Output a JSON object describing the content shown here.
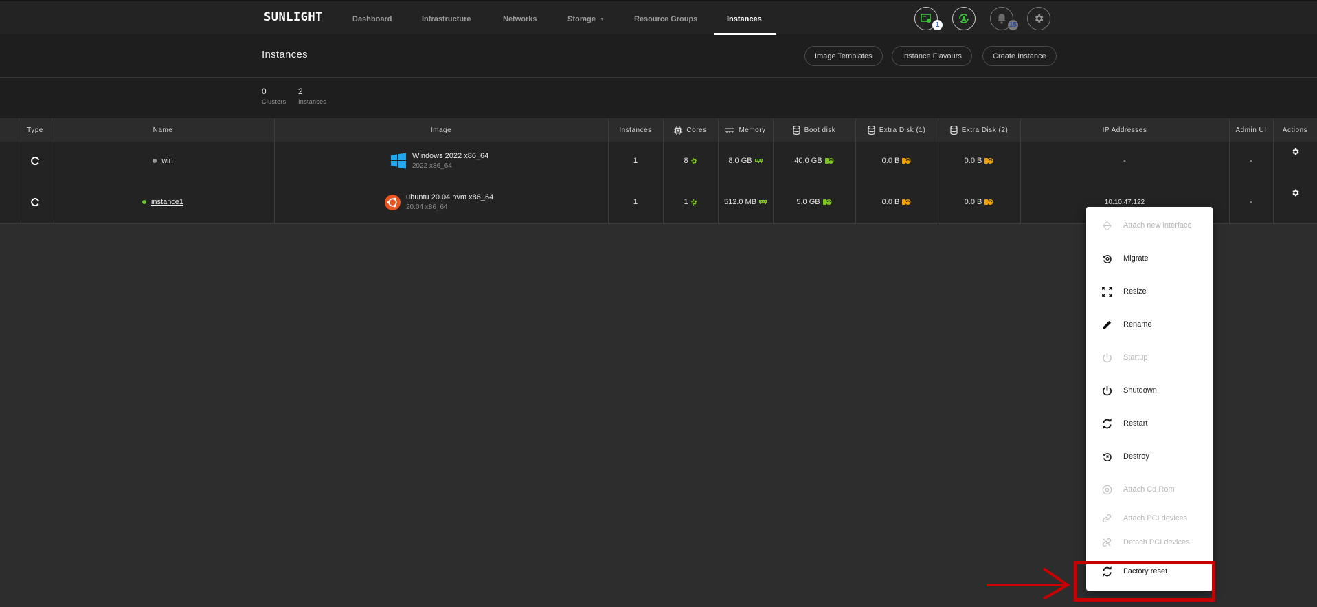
{
  "nav": {
    "logo": "SUNLIGHT",
    "items": [
      {
        "label": "Dashboard",
        "active": false
      },
      {
        "label": "Infrastructure",
        "active": false
      },
      {
        "label": "Networks",
        "active": false
      },
      {
        "label": "Storage",
        "active": false,
        "has_dropdown": true
      },
      {
        "label": "Resource Groups",
        "active": false
      },
      {
        "label": "Instances",
        "active": true
      }
    ],
    "icons": [
      {
        "name": "license-icon",
        "badge": "1"
      },
      {
        "name": "user-sync-icon",
        "badge": null
      },
      {
        "name": "bell-icon",
        "badge": "15"
      },
      {
        "name": "gear-icon",
        "badge": null
      }
    ]
  },
  "header": {
    "title": "Instances",
    "buttons": [
      "Image Templates",
      "Instance Flavours",
      "Create Instance"
    ]
  },
  "stats": [
    {
      "value": "0",
      "label": "Clusters"
    },
    {
      "value": "2",
      "label": "Instances"
    }
  ],
  "table": {
    "columns": [
      "Type",
      "Name",
      "Image",
      "Instances",
      "Cores",
      "Memory",
      "Boot disk",
      "Extra Disk (1)",
      "Extra Disk (2)",
      "IP Addresses",
      "Admin UI",
      "Actions"
    ],
    "rows": [
      {
        "name": "win",
        "status_color": "#9a9a9a",
        "image_title": "Windows 2022 x86_64",
        "image_sub": "2022 x86_64",
        "image_icon": "windows-icon",
        "instances": "1",
        "cores": "8",
        "memory": "8.0 GB",
        "boot_disk": "40.0 GB",
        "extra_disk_1": "0.0 B",
        "extra_disk_2": "0.0 B",
        "ip": "-",
        "admin_ui": "-"
      },
      {
        "name": "instance1",
        "status_color": "#6cc62a",
        "image_title": "ubuntu 20.04 hvm x86_64",
        "image_sub": "20.04 x86_64",
        "image_icon": "ubuntu-icon",
        "instances": "1",
        "cores": "1",
        "memory": "512.0 MB",
        "boot_disk": "5.0 GB",
        "extra_disk_1": "0.0 B",
        "extra_disk_2": "0.0 B",
        "ip": "10.10.47.122",
        "admin_ui": "-"
      }
    ]
  },
  "menu": {
    "items": [
      {
        "label": "Attach new interface",
        "icon": "network-interface-icon",
        "disabled": true
      },
      {
        "label": "Migrate",
        "icon": "migrate-icon",
        "disabled": false
      },
      {
        "label": "Resize",
        "icon": "resize-icon",
        "disabled": false
      },
      {
        "label": "Rename",
        "icon": "pencil-icon",
        "disabled": false
      },
      {
        "label": "Startup",
        "icon": "power-icon",
        "disabled": true
      },
      {
        "label": "Shutdown",
        "icon": "power-icon",
        "disabled": false
      },
      {
        "label": "Restart",
        "icon": "restart-icon",
        "disabled": false
      },
      {
        "label": "Destroy",
        "icon": "destroy-icon",
        "disabled": false
      },
      {
        "label": "Attach Cd Rom",
        "icon": "cdrom-icon",
        "disabled": true
      },
      {
        "label": "Attach PCI devices",
        "icon": "link-icon",
        "disabled": true
      },
      {
        "label": "Detach PCI devices",
        "icon": "unlink-icon",
        "disabled": true
      },
      {
        "label": "Factory reset",
        "icon": "restart-icon",
        "disabled": false
      }
    ]
  },
  "colors": {
    "accent_green": "#7cc41f",
    "warning_orange": "#f0a000",
    "annotation_red": "#c80000"
  }
}
